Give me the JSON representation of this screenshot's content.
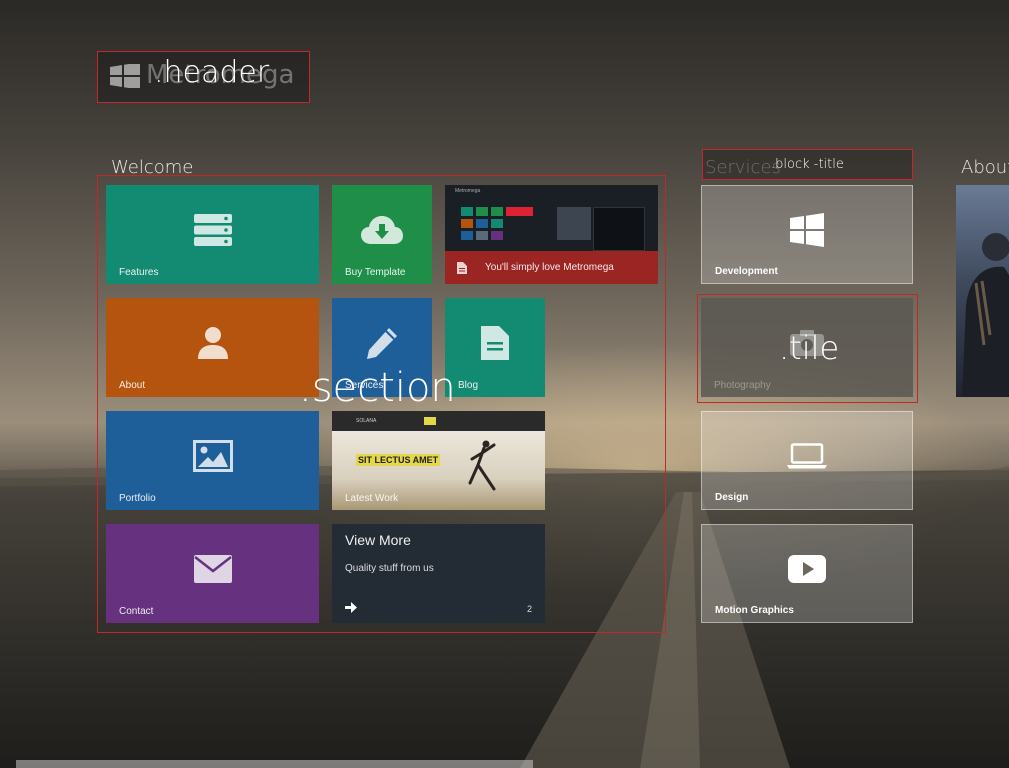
{
  "header": {
    "logo_text": "Metromega",
    "overlay_label": ".header"
  },
  "welcome": {
    "title": "Welcome",
    "overlay_label": ".section",
    "tiles": {
      "features": "Features",
      "buy_template": "Buy Template",
      "promo": "You'll simply love Metromega",
      "promo_caption": "Metromega",
      "about": "About",
      "services": "Services",
      "blog": "Blog",
      "portfolio": "Portfolio",
      "latest_work": "Latest Work",
      "latest_headline": "SIT LECTUS AMET",
      "latest_brand": "SOLANA",
      "contact": "Contact",
      "view_more_title": "View More",
      "view_more_sub": "Quality stuff from us",
      "view_more_count": "2"
    }
  },
  "services": {
    "title": "Services",
    "overlay_label": ".block -title",
    "tile_overlay_label": ".tile",
    "tiles": {
      "development": "Development",
      "photography": "Photography",
      "design": "Design",
      "motion": "Motion Graphics"
    }
  },
  "about": {
    "title": "About"
  },
  "colors": {
    "teal": "#138a72",
    "green": "#1e8e48",
    "orange": "#b4540e",
    "blue": "#1e5f9a",
    "purple": "#66317f",
    "dark": "#232b35",
    "red": "#9b2523",
    "overlay_border": "#c0282b"
  }
}
